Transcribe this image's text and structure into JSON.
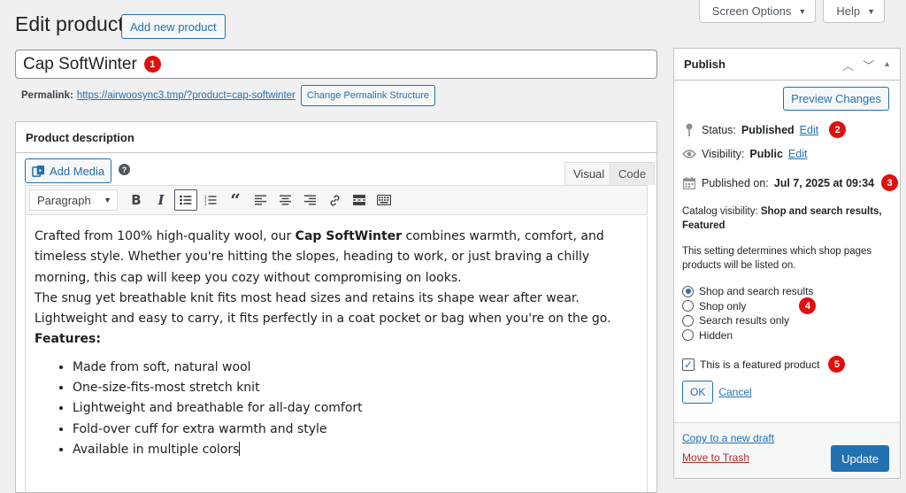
{
  "top_tabs": {
    "screen_options": "Screen Options",
    "help": "Help"
  },
  "header": {
    "title": "Edit product",
    "add_new": "Add new product"
  },
  "title_field": {
    "value": "Cap SoftWinter",
    "marker": "1"
  },
  "permalink": {
    "label": "Permalink:",
    "url": "https://airwoosync3.tmp/?product=cap-softwinter",
    "change_button": "Change Permalink Structure"
  },
  "description": {
    "heading": "Product description",
    "add_media": "Add Media",
    "help": "?",
    "tabs": {
      "visual": "Visual",
      "code": "Code"
    },
    "format": "Paragraph",
    "paragraph1_prefix": "Crafted from 100% high-quality wool, our ",
    "paragraph1_bold": "Cap SoftWinter",
    "paragraph1_suffix": " combines warmth, comfort, and timeless style. Whether you're hitting the slopes, heading to work, or just braving a chilly morning, this cap will keep you cozy without compromising on looks.",
    "paragraph2": "The snug yet breathable knit fits most head sizes and retains its shape wear after wear. Lightweight and easy to carry, it fits perfectly in a coat pocket or bag when you're on the go.",
    "features_heading": "Features:",
    "features": [
      "Made from soft, natural wool",
      "One-size-fits-most stretch knit",
      "Lightweight and breathable for all-day comfort",
      "Fold-over cuff for extra warmth and style",
      "Available in multiple colors"
    ]
  },
  "publish": {
    "title": "Publish",
    "preview": "Preview Changes",
    "status_label": "Status:",
    "status_value": "Published",
    "edit": "Edit",
    "visibility_label": "Visibility:",
    "visibility_value": "Public",
    "published_label": "Published on:",
    "published_value": "Jul 7, 2025 at 09:34",
    "catalog_label": "Catalog visibility:",
    "catalog_value": "Shop and search results, Featured",
    "catalog_desc": "This setting determines which shop pages products will be listed on.",
    "options": [
      "Shop and search results",
      "Shop only",
      "Search results only",
      "Hidden"
    ],
    "selected_index": 0,
    "featured_label": "This is a featured product",
    "featured_checked": true,
    "ok": "OK",
    "cancel": "Cancel",
    "copy_draft": "Copy to a new draft",
    "trash": "Move to Trash",
    "update": "Update",
    "markers": {
      "status": "2",
      "published": "3",
      "options": "4",
      "featured": "5"
    }
  },
  "colors": {
    "accent": "#2271b1",
    "marker": "#e0100f",
    "trash": "#b32d2e",
    "background": "#f0f0f1"
  }
}
